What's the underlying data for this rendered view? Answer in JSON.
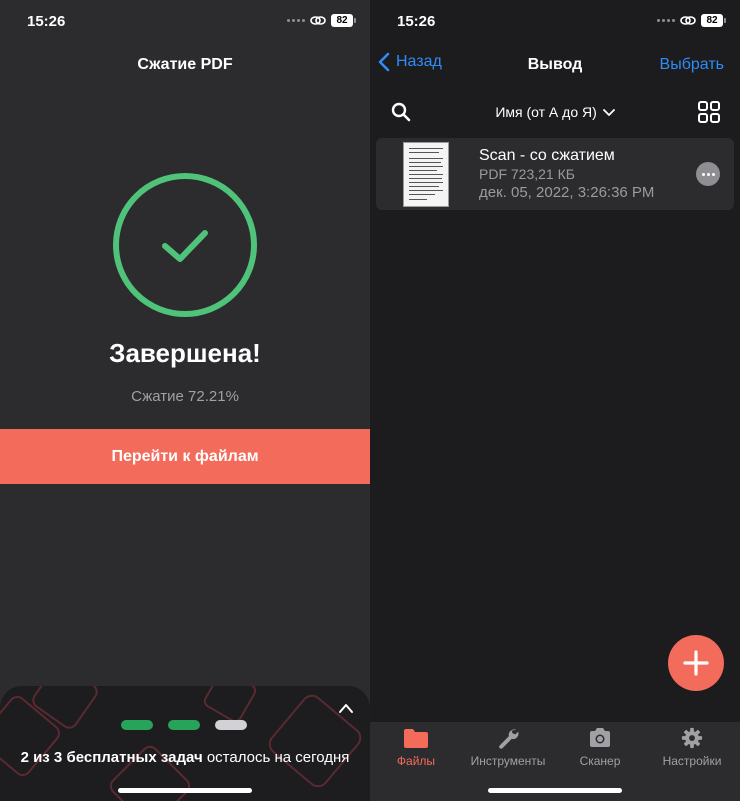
{
  "left": {
    "status": {
      "time": "15:26",
      "battery": "82"
    },
    "title": "Сжатие PDF",
    "result_title": "Завершена!",
    "compression_text": "Сжатие 72.21%",
    "go_button_label": "Перейти к файлам",
    "promo": {
      "bold_text": "2 из 3 бесплатных задач",
      "rest_text": " осталось на сегодня",
      "tasks_used": 2,
      "tasks_total": 3
    },
    "colors": {
      "success": "#4fc37a",
      "accent": "#f36b5b",
      "pill_used": "#27a35a",
      "pill_free": "#d1d1d6"
    }
  },
  "right": {
    "status": {
      "time": "15:26",
      "battery": "82"
    },
    "nav": {
      "back_label": "Назад",
      "title": "Вывод",
      "select_label": "Выбрать"
    },
    "sort_label": "Имя (от А до Я)",
    "files": [
      {
        "name": "Scan - со сжатием",
        "meta": "PDF 723,21 КБ",
        "date": "дек. 05, 2022, 3:26:36 PM"
      }
    ],
    "tabs": [
      {
        "label": "Файлы",
        "icon": "folder-icon",
        "active": true
      },
      {
        "label": "Инструменты",
        "icon": "wrench-icon",
        "active": false
      },
      {
        "label": "Сканер",
        "icon": "camera-icon",
        "active": false
      },
      {
        "label": "Настройки",
        "icon": "gear-icon",
        "active": false
      }
    ],
    "colors": {
      "link": "#2f8cf6",
      "accent": "#f36b5b"
    }
  }
}
